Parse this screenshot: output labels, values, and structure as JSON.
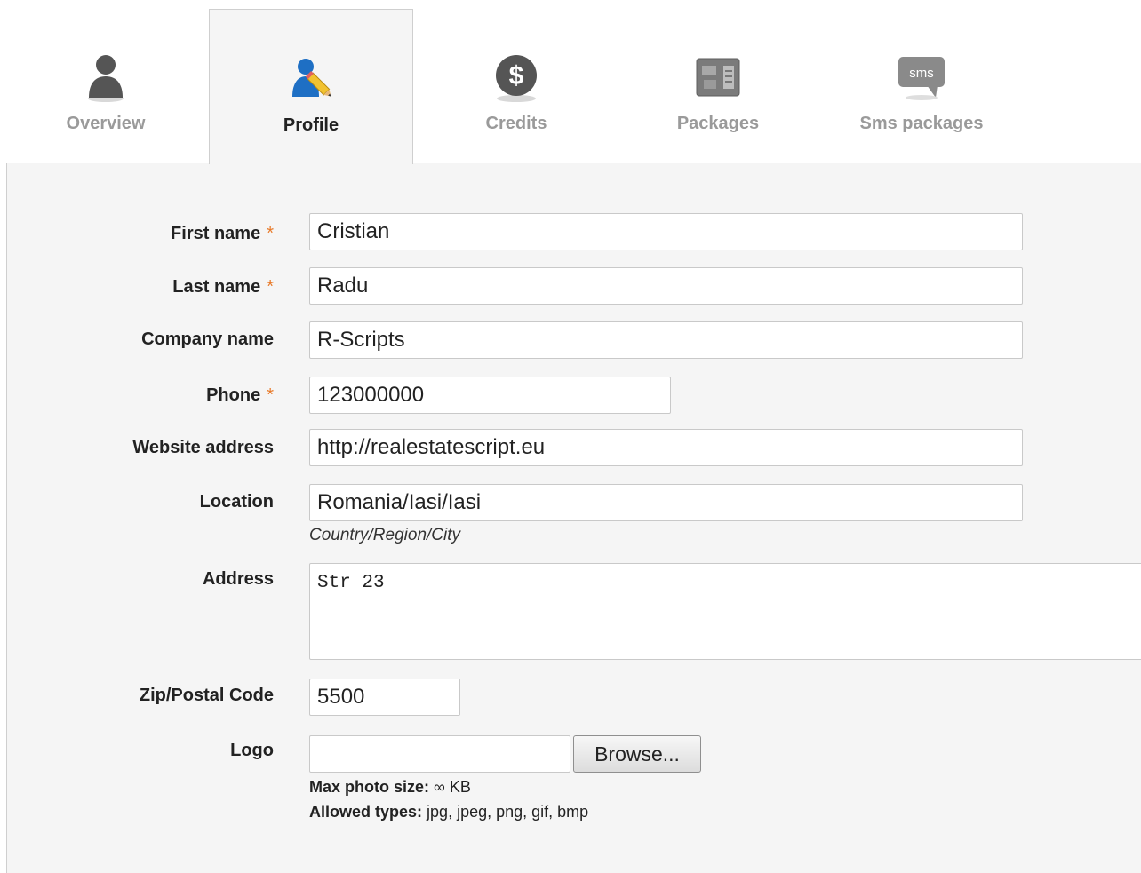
{
  "tabs": {
    "overview": {
      "label": "Overview",
      "icon": "user-icon"
    },
    "profile": {
      "label": "Profile",
      "icon": "user-edit-icon",
      "active": true
    },
    "credits": {
      "label": "Credits",
      "icon": "dollar-icon"
    },
    "packages": {
      "label": "Packages",
      "icon": "package-icon"
    },
    "sms": {
      "label": "Sms packages",
      "icon": "sms-bubble-icon",
      "icon_text": "sms"
    }
  },
  "form": {
    "first_name": {
      "label": "First name",
      "value": "Cristian",
      "required_mark": "*"
    },
    "last_name": {
      "label": "Last name",
      "value": "Radu",
      "required_mark": "*"
    },
    "company": {
      "label": "Company name",
      "value": "R-Scripts"
    },
    "phone": {
      "label": "Phone",
      "value": "123000000",
      "required_mark": "*"
    },
    "website": {
      "label": "Website address",
      "value": "http://realestatescript.eu"
    },
    "location": {
      "label": "Location",
      "value": "Romania/Iasi/Iasi",
      "hint": "Country/Region/City"
    },
    "address": {
      "label": "Address",
      "value": "Str 23"
    },
    "zip": {
      "label": "Zip/Postal Code",
      "value": "5500"
    },
    "logo": {
      "label": "Logo",
      "value": "",
      "browse_label": "Browse...",
      "max_size_label": "Max photo size:",
      "max_size_value": "∞ KB",
      "allowed_label": "Allowed types:",
      "allowed_value": "jpg, jpeg, png, gif, bmp"
    }
  },
  "colors": {
    "required": "#e87a2a",
    "panel_bg": "#f5f5f5",
    "inactive_tab_text": "#9a9a9a"
  }
}
